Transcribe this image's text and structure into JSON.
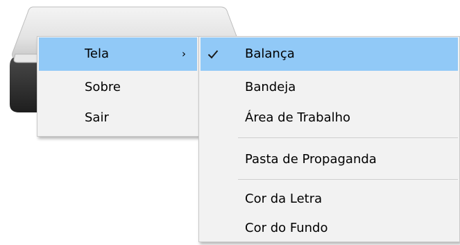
{
  "main_menu": {
    "items": [
      {
        "label": "Tela",
        "arrow": "›",
        "highlighted": true
      },
      {
        "label": "Sobre"
      },
      {
        "label": "Sair"
      }
    ]
  },
  "submenu": {
    "items": [
      {
        "label": "Balança",
        "checked": true,
        "check_icon": "checkmark-icon"
      },
      {
        "label": "Bandeja"
      },
      {
        "label": "Área de Trabalho"
      },
      {
        "label": "Pasta de Propaganda"
      },
      {
        "label": "Cor da Letra"
      },
      {
        "label": "Cor do Fundo"
      }
    ]
  },
  "colors": {
    "menu_background": "#f2f2f2",
    "highlight": "#91c9f7",
    "separator": "#cfcfcf",
    "checkmark": "#1a1a1a"
  },
  "background_icon": "scale-device-icon"
}
